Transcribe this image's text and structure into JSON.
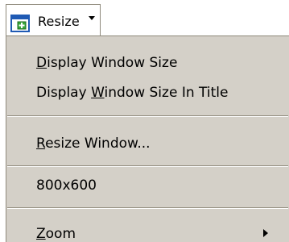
{
  "toolbar": {
    "resize_label": "Resize",
    "resize_icon": "window-resize-icon"
  },
  "menu": {
    "items": [
      {
        "pre": "",
        "accel": "D",
        "post": "isplay Window Size"
      },
      {
        "pre": "Display ",
        "accel": "W",
        "post": "indow Size In Title"
      },
      {
        "pre": "",
        "accel": "R",
        "post": "esize Window..."
      },
      {
        "pre": "800x600",
        "accel": "",
        "post": ""
      },
      {
        "pre": "",
        "accel": "Z",
        "post": "oom",
        "submenu": true
      }
    ]
  },
  "colors": {
    "menu_bg": "#d4d0c8",
    "border": "#8f8a7c",
    "icon_blue": "#1f5ab4",
    "icon_green": "#3aa93a"
  }
}
